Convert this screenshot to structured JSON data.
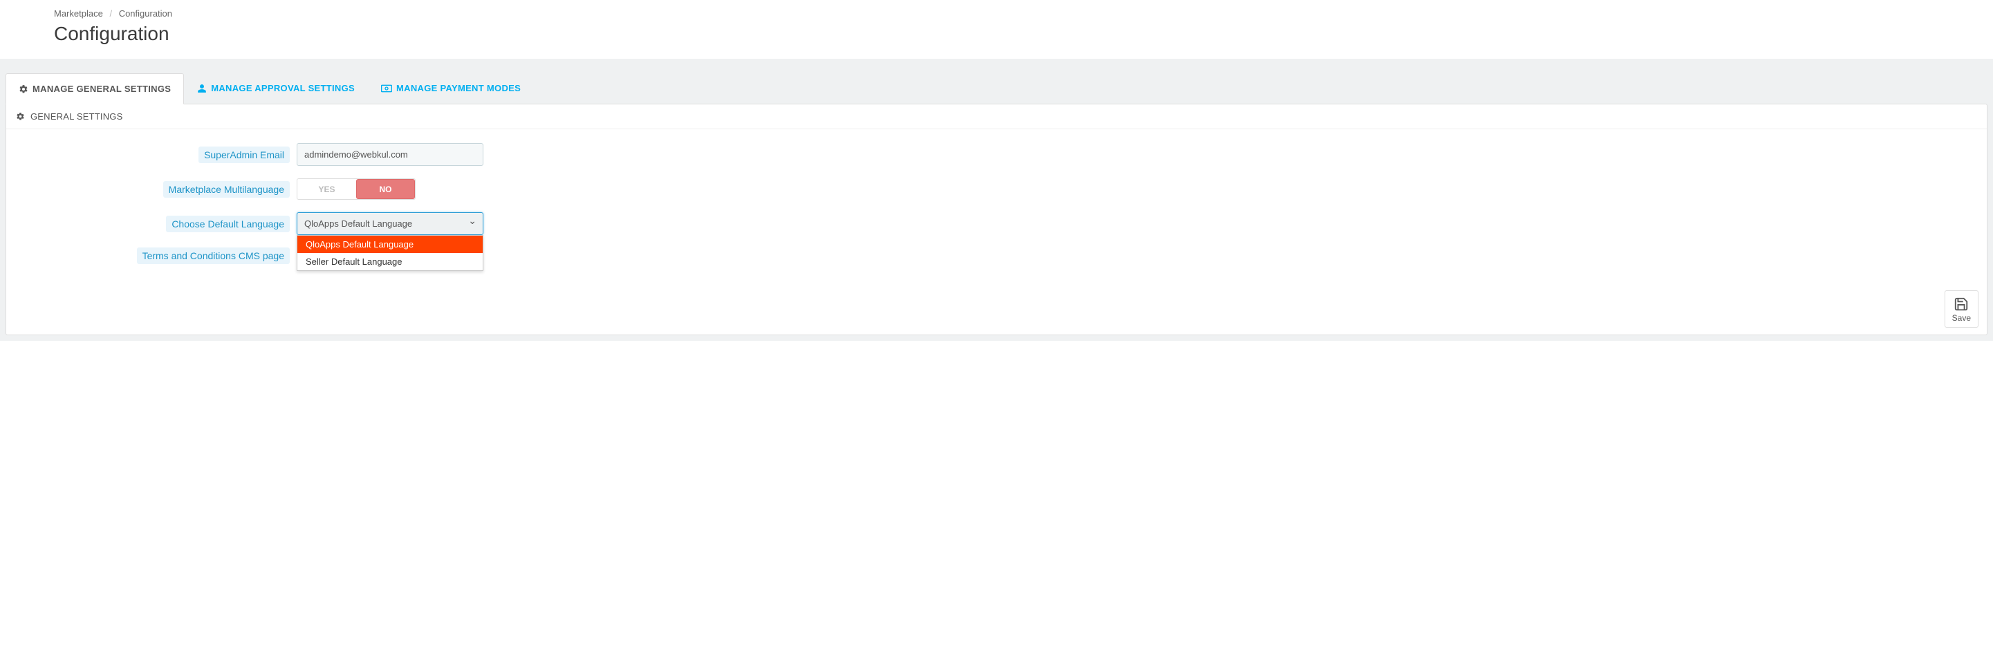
{
  "breadcrumb": {
    "root": "Marketplace",
    "current": "Configuration"
  },
  "page_title": "Configuration",
  "tabs": [
    {
      "label": "MANAGE GENERAL SETTINGS"
    },
    {
      "label": "MANAGE APPROVAL SETTINGS"
    },
    {
      "label": "MANAGE PAYMENT MODES"
    }
  ],
  "panel_heading": "GENERAL SETTINGS",
  "fields": {
    "superadmin_email": {
      "label": "SuperAdmin Email",
      "value": "admindemo@webkul.com"
    },
    "multilanguage": {
      "label": "Marketplace Multilanguage",
      "yes": "YES",
      "no": "NO",
      "value": "NO"
    },
    "default_language": {
      "label": "Choose Default Language",
      "selected": "QloApps Default Language",
      "options": [
        "QloApps Default Language",
        "Seller Default Language"
      ]
    },
    "terms_page": {
      "label": "Terms and Conditions CMS page"
    }
  },
  "save_button": "Save"
}
